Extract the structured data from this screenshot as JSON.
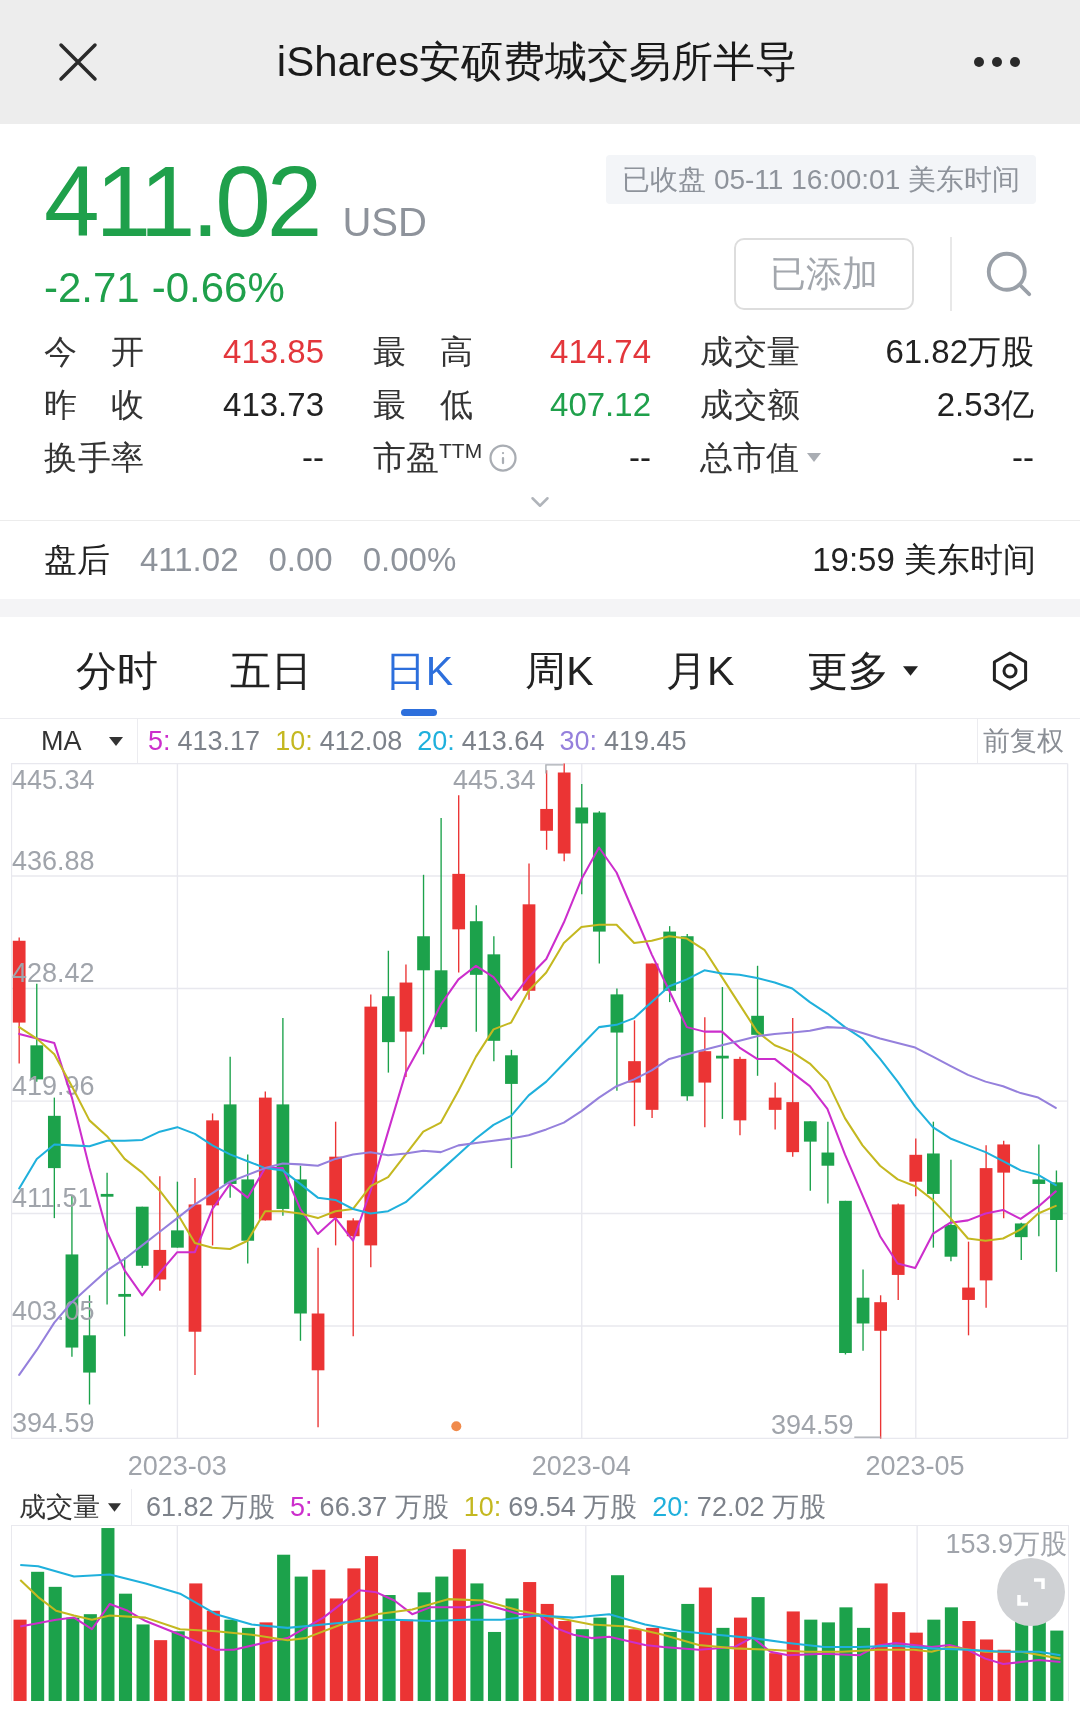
{
  "header": {
    "title": "iShares安硕费城交易所半导"
  },
  "quote": {
    "price": "411.02",
    "currency": "USD",
    "change": "-2.71",
    "change_percent": "-0.66%",
    "rising": false,
    "falling": true,
    "status": "已收盘 05-11 16:00:01 美东时间",
    "watchlist_button": "已添加"
  },
  "stats": [
    {
      "label": "今 开",
      "value": "413.85",
      "rising": true,
      "falling": false,
      "kind": "plain"
    },
    {
      "label": "最 高",
      "value": "414.74",
      "rising": true,
      "falling": false,
      "kind": "plain"
    },
    {
      "label": "成交量",
      "value": "61.82万股",
      "rising": false,
      "falling": false,
      "kind": "plain"
    },
    {
      "label": "昨 收",
      "value": "413.73",
      "rising": false,
      "falling": false,
      "kind": "plain"
    },
    {
      "label": "最 低",
      "value": "407.12",
      "rising": false,
      "falling": true,
      "kind": "plain"
    },
    {
      "label": "成交额",
      "value": "2.53亿",
      "rising": false,
      "falling": false,
      "kind": "plain"
    },
    {
      "label": "换手率",
      "value": "--",
      "rising": false,
      "falling": false,
      "kind": "plain"
    },
    {
      "label": "市盈$^{TTM}$",
      "value": "--",
      "rising": false,
      "falling": false,
      "kind": "info"
    },
    {
      "label": "总市值",
      "value": "--",
      "rising": false,
      "falling": false,
      "kind": "dropdown"
    }
  ],
  "after_hours": {
    "label": "盘后",
    "price": "411.02",
    "change": "0.00",
    "change_percent": "0.00%",
    "time": "19:59 美东时间"
  },
  "chart_tabs": [
    {
      "label": "分时",
      "selected": false,
      "kind": "plain"
    },
    {
      "label": "五日",
      "selected": false,
      "kind": "plain"
    },
    {
      "label": "日K",
      "selected": true,
      "kind": "plain"
    },
    {
      "label": "周K",
      "selected": false,
      "kind": "plain"
    },
    {
      "label": "月K",
      "selected": false,
      "kind": "plain"
    },
    {
      "label": "更多",
      "selected": false,
      "kind": "dropdown"
    }
  ],
  "indicator_bar": {
    "indicator": "MA",
    "values": [
      "413.17",
      "412.08",
      "413.64",
      "419.45"
    ],
    "adjustment": "前复权",
    "chart_data": {
      "type": "line",
      "ylim": [
        394.59,
        445.34
      ],
      "series": [
        {
          "name": "5:",
          "color": "#cc2ecc",
          "values": [
            425.01,
            424.66,
            424.32,
            420.22,
            414.92,
            410.14,
            407.23,
            405.36,
            407.06,
            408.6,
            408.6,
            411.85,
            413.73,
            412.7,
            414.92,
            414.92,
            411.85,
            409.97,
            411.16,
            409.46,
            413.22,
            417.66,
            422.1,
            424.49,
            427.23,
            429.11,
            430.13,
            429.28,
            427.57,
            429.28,
            430.64,
            433.38,
            436.63,
            439.02,
            437.14,
            434.06,
            430.99,
            428.25,
            425.52,
            425.18,
            425.18,
            423.98,
            423.13,
            423.13,
            422.1,
            421.08,
            419.37,
            415.95,
            412.87,
            409.8,
            407.75,
            407.41,
            409.97,
            410.82,
            410.99,
            411.51,
            411.78,
            411.1,
            412.02,
            413.17
          ]
        },
        {
          "name": "10:",
          "color": "#c4b820",
          "values": [
            425.52,
            424.66,
            423.47,
            421.08,
            418.51,
            417.32,
            415.61,
            414.58,
            413.22,
            411.51,
            409.29,
            408.94,
            408.84,
            409.46,
            411.68,
            411.68,
            411.51,
            411.16,
            411.68,
            411.85,
            413.56,
            414.24,
            415.95,
            417.66,
            418.34,
            420.73,
            423.3,
            425.35,
            425.86,
            428.25,
            429.62,
            431.84,
            433.04,
            433.21,
            433.21,
            431.84,
            432.01,
            432.35,
            432.18,
            431.33,
            429.28,
            427.23,
            425.18,
            424.15,
            423.64,
            422.78,
            421.42,
            418.68,
            416.63,
            415.1,
            414.07,
            413.56,
            412.53,
            411.16,
            409.63,
            409.46,
            409.63,
            410.31,
            411.51,
            412.08
          ]
        },
        {
          "name": "20:",
          "color": "#1fb0dc",
          "values": [
            413.39,
            415.61,
            416.7,
            416.63,
            416.56,
            416.97,
            416.97,
            417.04,
            417.66,
            418.0,
            417.49,
            416.63,
            415.95,
            415.44,
            414.92,
            414.75,
            413.73,
            412.7,
            412.53,
            411.85,
            411.51,
            411.68,
            412.36,
            413.56,
            414.75,
            415.95,
            417.15,
            418.17,
            418.85,
            420.39,
            421.42,
            422.78,
            424.15,
            425.52,
            425.69,
            426.2,
            427.4,
            428.59,
            429.11,
            429.79,
            429.55,
            429.45,
            429.21,
            428.87,
            428.42,
            427.4,
            426.54,
            425.52,
            424.66,
            423.13,
            421.42,
            419.54,
            418.0,
            417.15,
            416.63,
            416.12,
            415.44,
            414.75,
            414.41,
            413.64
          ]
        },
        {
          "name": "30:",
          "color": "#9580dc",
          "values": [
            399.37,
            401.25,
            403.3,
            404.84,
            406.04,
            407.23,
            408.09,
            409.11,
            410.14,
            411.16,
            412.19,
            413.04,
            413.9,
            414.41,
            414.92,
            415.27,
            415.2,
            415.1,
            415.61,
            415.95,
            416.12,
            415.88,
            416.02,
            416.22,
            416.12,
            416.63,
            416.8,
            416.97,
            417.15,
            417.39,
            417.83,
            418.34,
            419.2,
            420.22,
            421.08,
            421.59,
            422.27,
            423.13,
            423.47,
            423.81,
            424.15,
            424.49,
            424.83,
            425.01,
            425.11,
            425.25,
            425.52,
            425.45,
            425.07,
            424.66,
            424.32,
            423.98,
            423.3,
            422.61,
            421.93,
            421.42,
            421.08,
            420.56,
            420.22,
            419.45
          ]
        }
      ]
    }
  },
  "kline_chart": {
    "y_max_label": "445.34",
    "chart_data": {
      "type": "candlestick",
      "grid": true,
      "ylim": [
        394.59,
        445.34
      ],
      "yticks": [
        {
          "value": 436.88,
          "label": "436.88"
        },
        {
          "value": 428.42,
          "label": "428.42"
        },
        {
          "value": 419.96,
          "label": "419.96"
        },
        {
          "value": 411.51,
          "label": "411.51"
        },
        {
          "value": 403.05,
          "label": "403.05"
        },
        {
          "value": 394.59,
          "label": "394.59"
        }
      ],
      "categories": [
        null,
        null,
        null,
        null,
        null,
        null,
        null,
        null,
        null,
        "2023-03",
        null,
        null,
        null,
        null,
        null,
        null,
        null,
        null,
        null,
        null,
        null,
        null,
        null,
        null,
        null,
        null,
        null,
        null,
        null,
        null,
        null,
        null,
        "2023-04",
        null,
        null,
        null,
        null,
        null,
        null,
        null,
        null,
        null,
        null,
        null,
        null,
        null,
        null,
        null,
        null,
        null,
        null,
        "2023-05",
        null,
        null,
        null,
        null,
        null,
        null,
        null,
        null
      ],
      "ohlc": [
        [
          425.86,
          432.25,
          422.78,
          432.01
        ],
        [
          424.15,
          428.77,
          421.42,
          421.59
        ],
        [
          418.85,
          420.22,
          411.16,
          414.92
        ],
        [
          408.43,
          412.87,
          400.74,
          401.43
        ],
        [
          402.35,
          405.36,
          397.15,
          399.55
        ],
        [
          412.98,
          414.58,
          404.67,
          412.77
        ],
        [
          405.46,
          408.2,
          402.28,
          405.25
        ],
        [
          412.02,
          412.02,
          407.41,
          407.58
        ],
        [
          406.55,
          414.31,
          405.7,
          408.77
        ],
        [
          410.24,
          413.9,
          408.94,
          408.94
        ],
        [
          402.62,
          414.17,
          399.37,
          412.19
        ],
        [
          412.12,
          419.03,
          409.11,
          418.51
        ],
        [
          419.71,
          423.3,
          412.7,
          413.73
        ],
        [
          414.07,
          415.95,
          407.75,
          409.46
        ],
        [
          410.99,
          420.67,
          410.99,
          420.22
        ],
        [
          419.71,
          426.2,
          411.34,
          411.85
        ],
        [
          414.07,
          415.1,
          401.94,
          403.99
        ],
        [
          399.72,
          408.94,
          395.44,
          403.99
        ],
        [
          411.16,
          418.41,
          409.11,
          415.78
        ],
        [
          409.8,
          411.16,
          402.28,
          410.99
        ],
        [
          409.11,
          427.98,
          407.47,
          427.06
        ],
        [
          427.84,
          431.26,
          422.1,
          424.39
        ],
        [
          425.18,
          430.23,
          421.76,
          428.87
        ],
        [
          432.35,
          436.97,
          423.47,
          429.79
        ],
        [
          429.79,
          441.24,
          425.35,
          425.52
        ],
        [
          432.87,
          442.95,
          429.62,
          437.04
        ],
        [
          433.48,
          434.68,
          425.18,
          429.45
        ],
        [
          430.99,
          432.35,
          422.96,
          424.49
        ],
        [
          423.4,
          423.81,
          414.92,
          421.25
        ],
        [
          428.25,
          437.82,
          427.57,
          434.75
        ],
        [
          440.28,
          444.83,
          438.85,
          441.92
        ],
        [
          438.57,
          445.34,
          437.99,
          444.66
        ],
        [
          442.03,
          443.8,
          435.5,
          440.83
        ],
        [
          441.65,
          441.75,
          430.3,
          432.7
        ],
        [
          427.98,
          428.42,
          420.73,
          425.11
        ],
        [
          421.35,
          426.03,
          418.07,
          422.96
        ],
        [
          419.3,
          430.3,
          418.68,
          430.3
        ],
        [
          432.7,
          433.11,
          427.4,
          428.25
        ],
        [
          432.35,
          432.52,
          419.98,
          420.32
        ],
        [
          421.35,
          426.27,
          418.0,
          423.71
        ],
        [
          423.37,
          428.53,
          418.62,
          423.16
        ],
        [
          418.51,
          423.3,
          417.39,
          423.13
        ],
        [
          426.37,
          430.13,
          421.86,
          424.94
        ],
        [
          419.3,
          421.35,
          417.83,
          420.22
        ],
        [
          416.12,
          426.2,
          415.78,
          419.88
        ],
        [
          418.44,
          418.44,
          413.22,
          416.91
        ],
        [
          416.09,
          418.41,
          412.26,
          415.1
        ],
        [
          412.46,
          412.46,
          400.91,
          401.02
        ],
        [
          405.18,
          407.3,
          401.19,
          403.24
        ],
        [
          402.69,
          405.36,
          394.59,
          404.84
        ],
        [
          406.89,
          412.26,
          405.01,
          412.19
        ],
        [
          413.9,
          417.15,
          412.81,
          415.92
        ],
        [
          416.02,
          418.41,
          408.94,
          412.98
        ],
        [
          410.65,
          415.54,
          407.92,
          408.26
        ],
        [
          405.01,
          409.39,
          402.35,
          405.94
        ],
        [
          406.48,
          416.63,
          404.43,
          414.92
        ],
        [
          414.58,
          416.97,
          411.16,
          416.7
        ],
        [
          410.76,
          410.82,
          408.02,
          409.73
        ],
        [
          414.07,
          416.7,
          409.8,
          413.73
        ],
        [
          413.85,
          414.74,
          407.12,
          411.02
        ]
      ]
    },
    "high_label": "445.34",
    "low_label": "394.59"
  },
  "volume": {
    "label": "成交量",
    "total": "61.82 万股",
    "items": [
      {
        "key": "5:",
        "value": "66.37 万股",
        "color": "#cc2ecc"
      },
      {
        "key": "10:",
        "value": "69.54 万股",
        "color": "#c4b820"
      },
      {
        "key": "20:",
        "value": "72.02 万股",
        "color": "#1fb0dc"
      }
    ],
    "max_label": "153.9万股"
  }
}
